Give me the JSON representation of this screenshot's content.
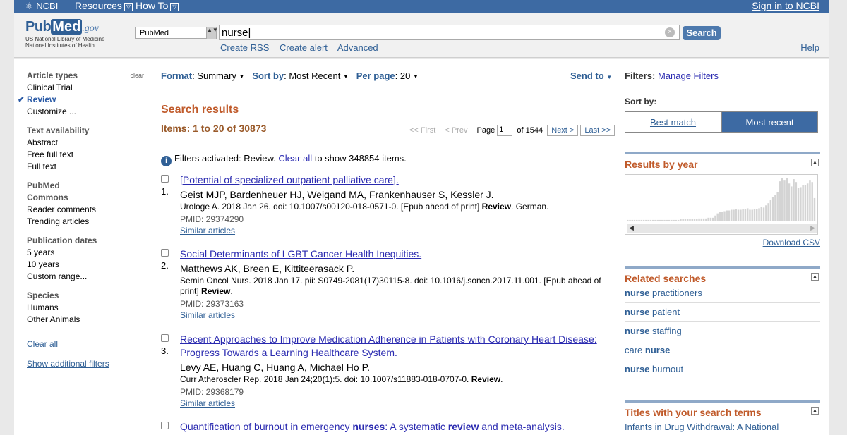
{
  "topbar": {
    "logo": "NCBI",
    "resources": "Resources",
    "howto": "How To",
    "signin": "Sign in to NCBI",
    "dd": "▽"
  },
  "logo": {
    "pub": "Pub",
    "med": "Med",
    "gov": ".gov",
    "line1": "US National Library of Medicine",
    "line2": "National Institutes of Health"
  },
  "search": {
    "database": "PubMed",
    "query": "nurse",
    "button": "Search",
    "clear_glyph": "×",
    "select_arrows": "▲▼"
  },
  "sublinks": [
    "Create RSS",
    "Create alert",
    "Advanced"
  ],
  "help": "Help",
  "sidebar": {
    "clear": "clear",
    "groups": [
      {
        "heading": "Article types",
        "items": [
          "Clinical Trial",
          "Review",
          "Customize ..."
        ],
        "selected": "Review"
      },
      {
        "heading": "Text availability",
        "items": [
          "Abstract",
          "Free full text",
          "Full text"
        ]
      },
      {
        "heading": "PubMed Commons",
        "items": [
          "Reader comments",
          "Trending articles"
        ]
      },
      {
        "heading": "Publication dates",
        "items": [
          "5 years",
          "10 years",
          "Custom range..."
        ]
      },
      {
        "heading": "Species",
        "items": [
          "Humans",
          "Other Animals"
        ]
      }
    ],
    "clear_all": "Clear all",
    "show_filters": "Show additional filters"
  },
  "options": {
    "format_label": "Format",
    "format_value": "Summary",
    "sort_label": "Sort by",
    "sort_value": "Most Recent",
    "perpage_label": "Per page",
    "perpage_value": "20",
    "send_to": "Send to"
  },
  "results": {
    "title": "Search results",
    "items_text": "Items: 1 to 20 of 30873",
    "pager": {
      "first": "<< First",
      "prev": "< Prev",
      "page_label": "Page",
      "page": "1",
      "of": "of 1544",
      "next": "Next >",
      "last": "Last >>"
    },
    "notice_pre": "Filters activated: Review.",
    "notice_link": "Clear all",
    "notice_post": "to show 348854 items.",
    "list": [
      {
        "num": "1.",
        "title": "[Potential of specialized outpatient palliative care].",
        "authors": "Geist MJP, Bardenheuer HJ, Weigand MA, Frankenhauser S, Kessler J.",
        "journal": "Urologe A. 2018 Jan 26. doi: 10.1007/s00120-018-0571-0. [Epub ahead of print]",
        "journal_post": ". German.",
        "pmid": "PMID: 29374290",
        "similar": "Similar articles"
      },
      {
        "num": "2.",
        "title": "Social Determinants of LGBT Cancer Health Inequities.",
        "authors": "Matthews AK, Breen E, Kittiteerasack P.",
        "journal": "Semin Oncol Nurs. 2018 Jan 17. pii: S0749-2081(17)30115-8. doi: 10.1016/j.soncn.2017.11.001. [Epub ahead of print]",
        "journal_post": ".",
        "pmid": "PMID: 29373163",
        "similar": "Similar articles"
      },
      {
        "num": "3.",
        "title": "Recent Approaches to Improve Medication Adherence in Patients with Coronary Heart Disease: Progress Towards a Learning Healthcare System.",
        "authors": "Levy AE, Huang C, Huang A, Michael Ho P.",
        "journal": "Curr Atheroscler Rep. 2018 Jan 24;20(1):5. doi: 10.1007/s11883-018-0707-0.",
        "journal_post": ".",
        "pmid": "PMID: 29368179",
        "similar": "Similar articles"
      }
    ],
    "review_word": "Review",
    "item4": {
      "t1": "Quantification of burnout in emergency ",
      "t2": "nurses",
      "t3": ": A systematic ",
      "t4": "review",
      "t5": " and meta-analysis."
    }
  },
  "right": {
    "filters_label": "Filters:",
    "manage_filters": "Manage Filters",
    "sortby": "Sort by:",
    "best_match": "Best match",
    "most_recent": "Most recent",
    "results_by_year": "Results by year",
    "download_csv": "Download CSV",
    "scroll_left": "◀",
    "scroll_right": "▶",
    "toggle": "▲",
    "related_title": "Related searches",
    "related": [
      {
        "pre": "",
        "bold": "nurse",
        "post": " practitioners"
      },
      {
        "pre": "",
        "bold": "nurse",
        "post": " patient"
      },
      {
        "pre": "",
        "bold": "nurse",
        "post": " staffing"
      },
      {
        "pre": "care ",
        "bold": "nurse",
        "post": ""
      },
      {
        "pre": "",
        "bold": "nurse",
        "post": " burnout"
      }
    ],
    "titles_title": "Titles with your search terms",
    "titles_item": "Infants in Drug Withdrawal: A National"
  },
  "chart_data": {
    "type": "bar",
    "title": "Results by year",
    "values": [
      2,
      2,
      2,
      2,
      2,
      2,
      2,
      2,
      2,
      2,
      2,
      2,
      2,
      2,
      2,
      2,
      2,
      2,
      2,
      2,
      2,
      2,
      2,
      3,
      3,
      3,
      3,
      3,
      3,
      3,
      3,
      4,
      4,
      4,
      4,
      5,
      5,
      5,
      8,
      11,
      13,
      13,
      14,
      15,
      15,
      16,
      16,
      17,
      16,
      16,
      17,
      17,
      18,
      16,
      16,
      17,
      17,
      18,
      20,
      19,
      22,
      25,
      29,
      33,
      36,
      40,
      55,
      60,
      56,
      60,
      52,
      48,
      58,
      54,
      46,
      47,
      50,
      50,
      52,
      56,
      54,
      32
    ]
  }
}
